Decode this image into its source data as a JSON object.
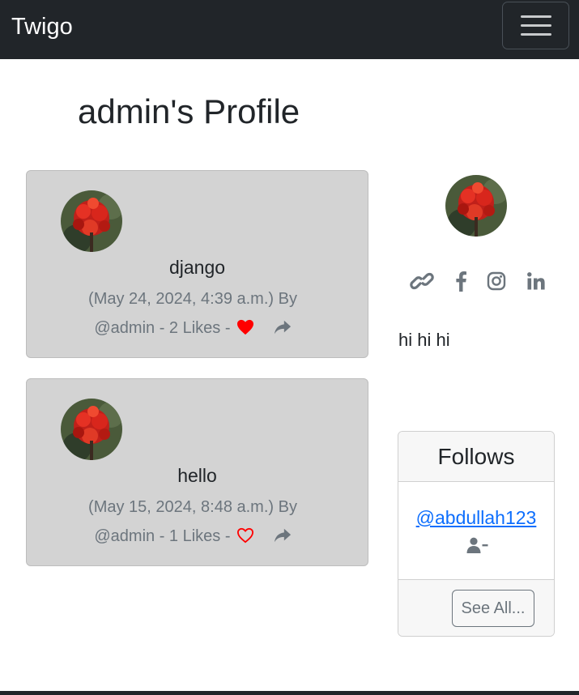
{
  "navbar": {
    "brand": "Twigo",
    "toggler_icon": "hamburger-menu-icon",
    "background": "#212529"
  },
  "page": {
    "title": "admin's Profile"
  },
  "posts": [
    {
      "body": "django",
      "date_by": "(May 24, 2024, 4:39 a.m.) By",
      "author_likes": "@admin - 2 Likes -",
      "liked": true,
      "heart_icon": "heart-filled-icon",
      "share_icon": "share-icon"
    },
    {
      "body": "hello",
      "date_by": "(May 15, 2024, 8:48 a.m.) By",
      "author_likes": "@admin - 1 Likes -",
      "liked": false,
      "heart_icon": "heart-outline-icon",
      "share_icon": "share-icon"
    }
  ],
  "sidebar": {
    "social_icons": [
      "link-icon",
      "facebook-icon",
      "instagram-icon",
      "linkedin-icon"
    ],
    "bio": "hi hi hi",
    "follows": {
      "title": "Follows",
      "items": [
        {
          "username": "@abdullah123",
          "action_icon": "user-minus-icon"
        }
      ],
      "see_all_label": "See All..."
    }
  },
  "colors": {
    "card_bg": "#d3d3d3",
    "heart": "#ff0000",
    "muted": "#6c757d",
    "link": "#0d6efd"
  }
}
